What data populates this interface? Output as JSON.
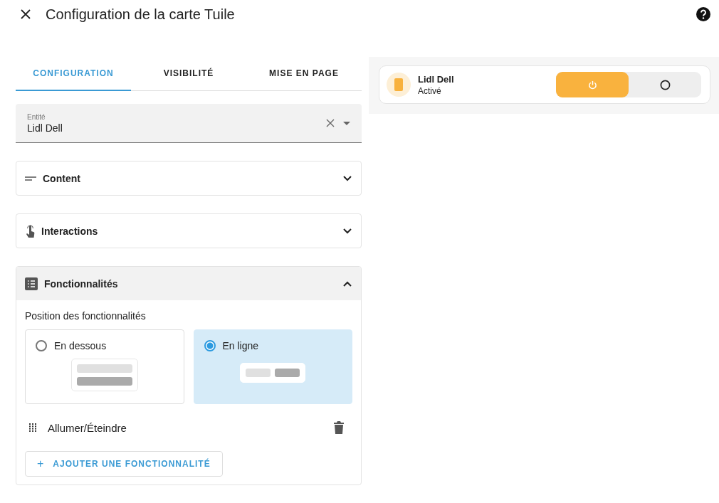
{
  "dialog": {
    "title": "Configuration de la carte Tuile"
  },
  "tabs": [
    {
      "label": "CONFIGURATION",
      "selected": true
    },
    {
      "label": "VISIBILITÉ",
      "selected": false
    },
    {
      "label": "MISE EN PAGE",
      "selected": false
    }
  ],
  "entity_field": {
    "label": "Entité",
    "value": "Lidl Dell"
  },
  "sections": [
    {
      "kind": "content",
      "title": "Content",
      "expanded": false
    },
    {
      "kind": "interactions",
      "title": "Interactions",
      "expanded": false
    },
    {
      "kind": "features",
      "title": "Fonctionnalités",
      "expanded": true
    }
  ],
  "features": {
    "position_label": "Position des fonctionnalités",
    "positions": [
      {
        "kind": "below",
        "label": "En dessous",
        "selected": false
      },
      {
        "kind": "inline",
        "label": "En ligne",
        "selected": true
      }
    ],
    "items": [
      {
        "label": "Allumer/Éteindre"
      }
    ],
    "add_button": {
      "icon": "+",
      "label": "AJOUTER UNE FONCTIONNALITÉ"
    }
  },
  "preview": {
    "name": "Lidl Dell",
    "state": "Activé",
    "toggle": [
      {
        "kind": "on",
        "selected": true
      },
      {
        "kind": "off",
        "selected": false
      }
    ]
  }
}
